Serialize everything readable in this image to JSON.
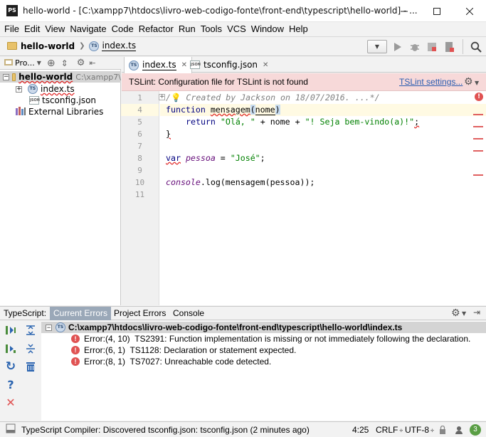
{
  "window": {
    "app_icon": "PS",
    "title": "hello-world - [C:\\xampp7\\htdocs\\livro-web-codigo-fonte\\front-end\\typescript\\hello-world] - ..."
  },
  "menu": {
    "items": [
      "File",
      "Edit",
      "View",
      "Navigate",
      "Code",
      "Refactor",
      "Run",
      "Tools",
      "VCS",
      "Window",
      "Help"
    ]
  },
  "navbar": {
    "project": "hello-world",
    "file": "index.ts"
  },
  "project_panel": {
    "toolbar_label": "Pro...",
    "root": {
      "name": "hello-world",
      "path": "C:\\xampp7\\"
    },
    "items": [
      {
        "name": "index.ts",
        "icon": "ts"
      },
      {
        "name": "tsconfig.json",
        "icon": "json"
      }
    ],
    "libraries": "External Libraries"
  },
  "editor": {
    "tabs": [
      {
        "label": "index.ts",
        "icon": "ts",
        "active": true
      },
      {
        "label": "tsconfig.json",
        "icon": "json",
        "active": false
      }
    ],
    "banner": {
      "message": "TSLint: Configuration file for TSLint is not found",
      "link": "TSLint settings..."
    },
    "line_numbers": [
      "1",
      "4",
      "5",
      "6",
      "7",
      "8",
      "9",
      "10",
      "11"
    ],
    "code": {
      "l1": "Created by Jackson on 18/07/2016. ...*/",
      "l4_kw": "function",
      "l4_fn": "mensagem",
      "l4_param": "nome",
      "l5_kw": "return",
      "l5_s1": "\"Olá, \"",
      "l5_mid": " + nome + ",
      "l5_s2": "\"! Seja bem-vindo(a)!\"",
      "l5_end": ";",
      "l6": "}",
      "l8_kw": "var",
      "l8_name": "pessoa",
      "l8_eq": " = ",
      "l8_str": "\"José\"",
      "l8_end": ";",
      "l10_obj": "console",
      "l10_rest": ".log(mensagem(pessoa));"
    }
  },
  "bottom_panel": {
    "label": "TypeScript:",
    "tabs": [
      {
        "label": "Current Errors",
        "active": true
      },
      {
        "label": "Project Errors",
        "active": false
      },
      {
        "label": "Console",
        "active": false
      }
    ],
    "file_path": "C:\\xampp7\\htdocs\\livro-web-codigo-fonte\\front-end\\typescript\\hello-world\\index.ts",
    "errors": [
      "Error:(4, 10)  TS2391: Function implementation is missing or not immediately following the declaration.",
      "Error:(6, 1)  TS1128: Declaration or statement expected.",
      "Error:(8, 1)  TS7027: Unreachable code detected."
    ]
  },
  "statusbar": {
    "message": "TypeScript Compiler: Discovered tsconfig.json: tsconfig.json (2 minutes ago)",
    "position": "4:25",
    "line_sep": "CRLF",
    "encoding": "UTF-8",
    "badge": "3"
  },
  "colors": {
    "keyword": "#000080",
    "string": "#008000",
    "comment": "#808080",
    "error": "#e05252",
    "banner_bg": "#f7d9d9",
    "link": "#2a5db0"
  }
}
